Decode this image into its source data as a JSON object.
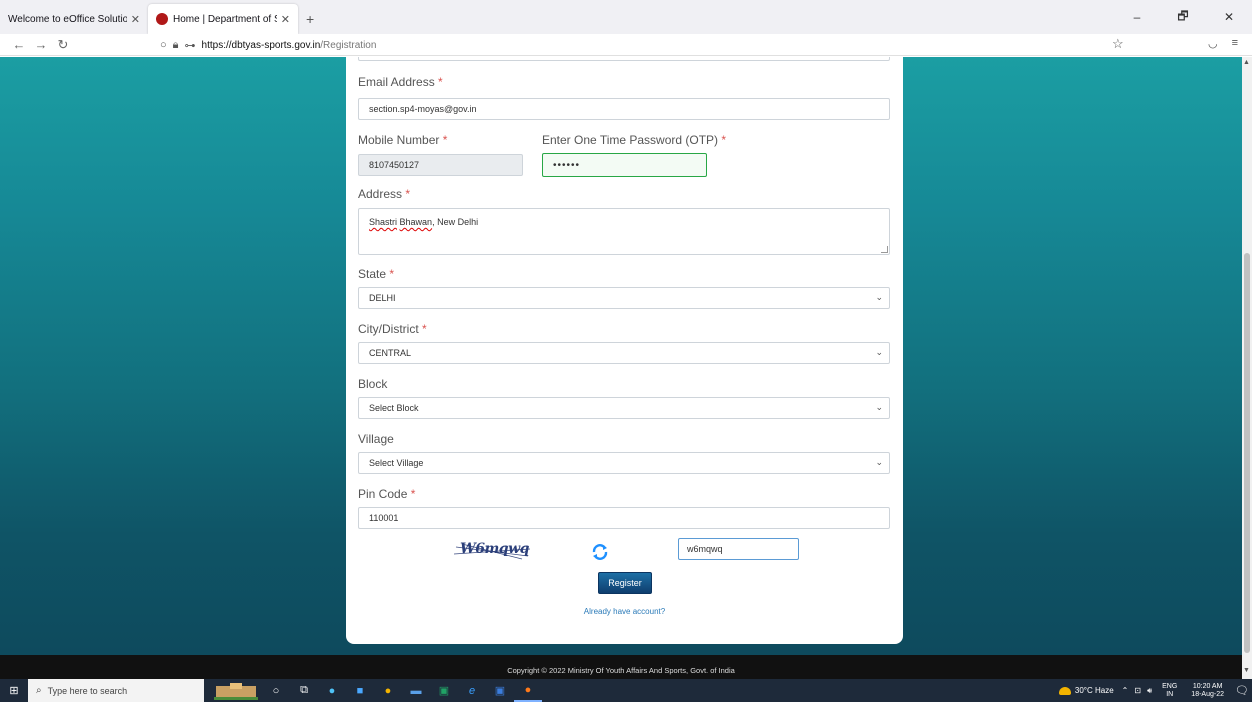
{
  "browser": {
    "tabs": [
      {
        "label": "Welcome to eOffice Solution",
        "active": false
      },
      {
        "label": "Home | Department of Sports",
        "active": true
      }
    ],
    "new_tab_label": "+",
    "url_host": "https://dbtyas-sports.gov.in",
    "url_path": "/Registration",
    "window_controls": [
      "–",
      "🗗",
      "✕"
    ]
  },
  "form": {
    "email": {
      "label": "Email Address",
      "value": "section.sp4-moyas@gov.in"
    },
    "mobile": {
      "label": "Mobile Number",
      "value": "8107450127"
    },
    "otp": {
      "label": "Enter One Time Password (OTP)",
      "value": "••••••"
    },
    "address": {
      "label": "Address",
      "value_word1": "Shastri",
      "value_word2": "Bhawan",
      "value_rest": ", New Delhi"
    },
    "state": {
      "label": "State",
      "value": "DELHI"
    },
    "city": {
      "label": "City/District",
      "value": "CENTRAL"
    },
    "block": {
      "label": "Block",
      "value": "Select Block"
    },
    "village": {
      "label": "Village",
      "value": "Select Village"
    },
    "pincode": {
      "label": "Pin Code",
      "value": "110001"
    },
    "captcha": {
      "image_text": "W6mqwq",
      "input_value": "w6mqwq"
    },
    "register_label": "Register",
    "already_account": "Already have account?",
    "required_mark": "*"
  },
  "footer": {
    "copyright": "Copyright © 2022 Ministry Of Youth Affairs And Sports, Govt. of India"
  },
  "taskbar": {
    "search_placeholder": "Type here to search",
    "weather": "30°C Haze",
    "lang_top": "ENG",
    "lang_bottom": "IN",
    "time": "10:20 AM",
    "date": "18-Aug-22"
  },
  "colors": {
    "page_gradient_top": "#1b9ea3",
    "page_gradient_bottom": "#0e4a5d",
    "required": "#d9534f",
    "otp_border": "#28a745",
    "register_button": "#0f3e6e"
  }
}
